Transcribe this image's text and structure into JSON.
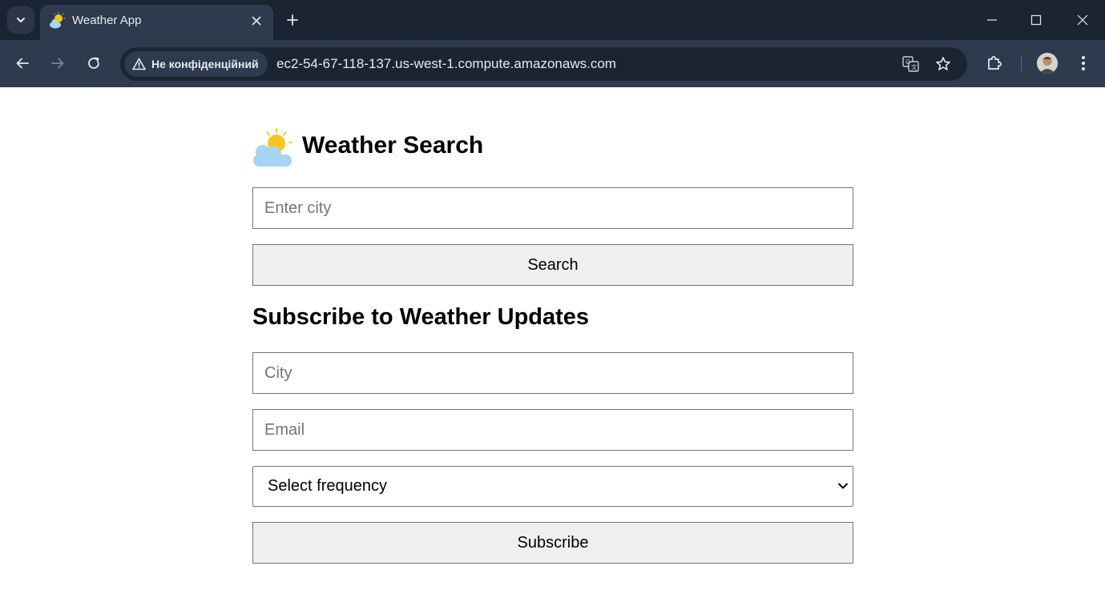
{
  "browser": {
    "tab": {
      "title": "Weather App",
      "favicon": "sun-behind-cloud-icon"
    },
    "security_label": "Не конфіденційний",
    "url": "ec2-54-67-118-137.us-west-1.compute.amazonaws.com"
  },
  "page": {
    "header_icon": "sun-behind-cloud-emoji",
    "title": "Weather Search",
    "search": {
      "placeholder": "Enter city",
      "value": "",
      "button_label": "Search"
    },
    "subscribe": {
      "title": "Subscribe to Weather Updates",
      "city_placeholder": "City",
      "email_placeholder": "Email",
      "frequency_selected": "Select frequency",
      "button_label": "Subscribe"
    }
  }
}
